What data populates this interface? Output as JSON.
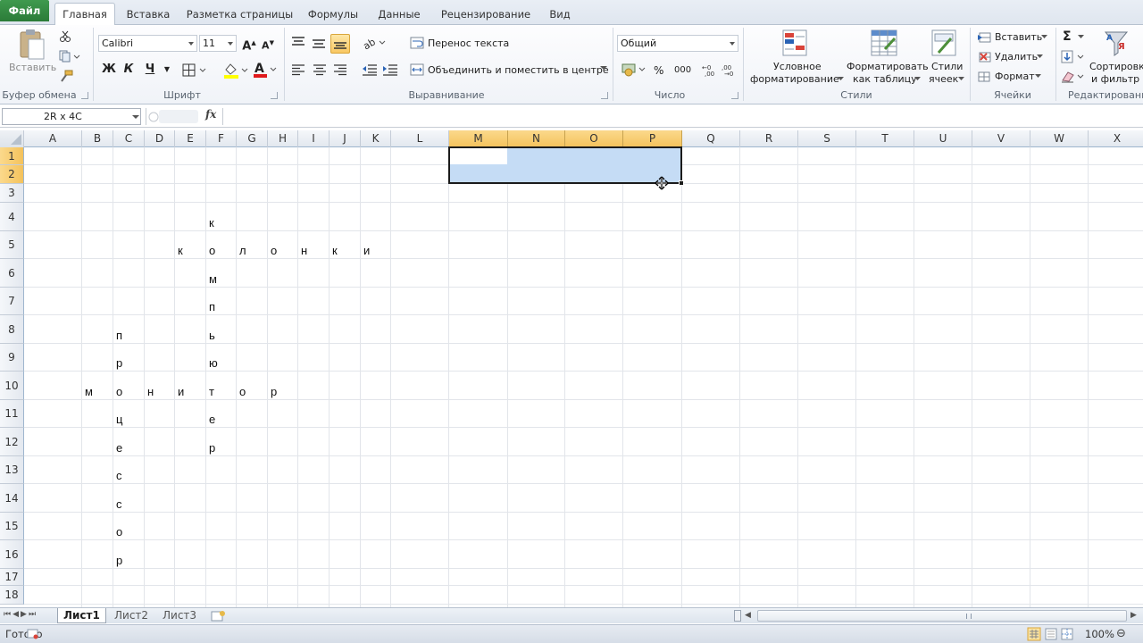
{
  "tabs": {
    "file": "Файл",
    "items": [
      "Главная",
      "Вставка",
      "Разметка страницы",
      "Формулы",
      "Данные",
      "Рецензирование",
      "Вид"
    ]
  },
  "ribbon": {
    "clipboard": {
      "paste": "Вставить",
      "label": "Буфер обмена"
    },
    "font": {
      "name": "Calibri",
      "size": "11",
      "bold": "Ж",
      "italic": "К",
      "underline": "Ч",
      "label": "Шрифт",
      "highlight_color": "#ffff00",
      "font_color": "#e0191c"
    },
    "alignment": {
      "wrap": "Перенос текста",
      "merge": "Объединить и поместить в центре",
      "label": "Выравнивание"
    },
    "number": {
      "format": "Общий",
      "percent": "%",
      "thousands": "000",
      "label": "Число"
    },
    "styles": {
      "conditional1": "Условное",
      "conditional2": "форматирование",
      "table1": "Форматировать",
      "table2": "как таблицу",
      "cell1": "Стили",
      "cell2": "ячеек",
      "label": "Стили"
    },
    "cells": {
      "insert": "Вставить",
      "delete": "Удалить",
      "format": "Формат",
      "label": "Ячейки"
    },
    "editing": {
      "sum": "Σ",
      "sort1": "Сортировка",
      "sort2": "и фильтр",
      "label": "Редактирование"
    }
  },
  "formula_bar": {
    "name_box": "2R x 4C",
    "fx": "fx",
    "formula": ""
  },
  "columns": [
    "A",
    "B",
    "C",
    "D",
    "E",
    "F",
    "G",
    "H",
    "I",
    "J",
    "K",
    "L",
    "M",
    "N",
    "O",
    "P",
    "Q",
    "R",
    "S",
    "T",
    "U",
    "V",
    "W",
    "X"
  ],
  "rows": [
    "1",
    "2",
    "3",
    "4",
    "5",
    "6",
    "7",
    "8",
    "9",
    "10",
    "11",
    "12",
    "13",
    "14",
    "15",
    "16",
    "17",
    "18"
  ],
  "cells": [
    {
      "col": "F",
      "row": 4,
      "v": "к"
    },
    {
      "col": "E",
      "row": 5,
      "v": "к"
    },
    {
      "col": "F",
      "row": 5,
      "v": "о"
    },
    {
      "col": "G",
      "row": 5,
      "v": "л"
    },
    {
      "col": "H",
      "row": 5,
      "v": "о"
    },
    {
      "col": "I",
      "row": 5,
      "v": "н"
    },
    {
      "col": "J",
      "row": 5,
      "v": "к"
    },
    {
      "col": "K",
      "row": 5,
      "v": "и"
    },
    {
      "col": "F",
      "row": 6,
      "v": "м"
    },
    {
      "col": "F",
      "row": 7,
      "v": "п"
    },
    {
      "col": "C",
      "row": 8,
      "v": "п"
    },
    {
      "col": "F",
      "row": 8,
      "v": "ь"
    },
    {
      "col": "C",
      "row": 9,
      "v": "р"
    },
    {
      "col": "F",
      "row": 9,
      "v": "ю"
    },
    {
      "col": "B",
      "row": 10,
      "v": "м"
    },
    {
      "col": "C",
      "row": 10,
      "v": "о"
    },
    {
      "col": "D",
      "row": 10,
      "v": "н"
    },
    {
      "col": "E",
      "row": 10,
      "v": "и"
    },
    {
      "col": "F",
      "row": 10,
      "v": "т"
    },
    {
      "col": "G",
      "row": 10,
      "v": "о"
    },
    {
      "col": "H",
      "row": 10,
      "v": "р"
    },
    {
      "col": "C",
      "row": 11,
      "v": "ц"
    },
    {
      "col": "F",
      "row": 11,
      "v": "е"
    },
    {
      "col": "C",
      "row": 12,
      "v": "е"
    },
    {
      "col": "F",
      "row": 12,
      "v": "р"
    },
    {
      "col": "C",
      "row": 13,
      "v": "с"
    },
    {
      "col": "C",
      "row": 14,
      "v": "с"
    },
    {
      "col": "C",
      "row": 15,
      "v": "о"
    },
    {
      "col": "C",
      "row": 16,
      "v": "р"
    }
  ],
  "selection": {
    "range": "M1:P2",
    "fill": "#c5dcf5",
    "border": "#1b1b1b"
  },
  "sheets": [
    "Лист1",
    "Лист2",
    "Лист3"
  ],
  "active_sheet": "Лист1",
  "status": {
    "ready": "Готово",
    "zoom": "100%"
  }
}
